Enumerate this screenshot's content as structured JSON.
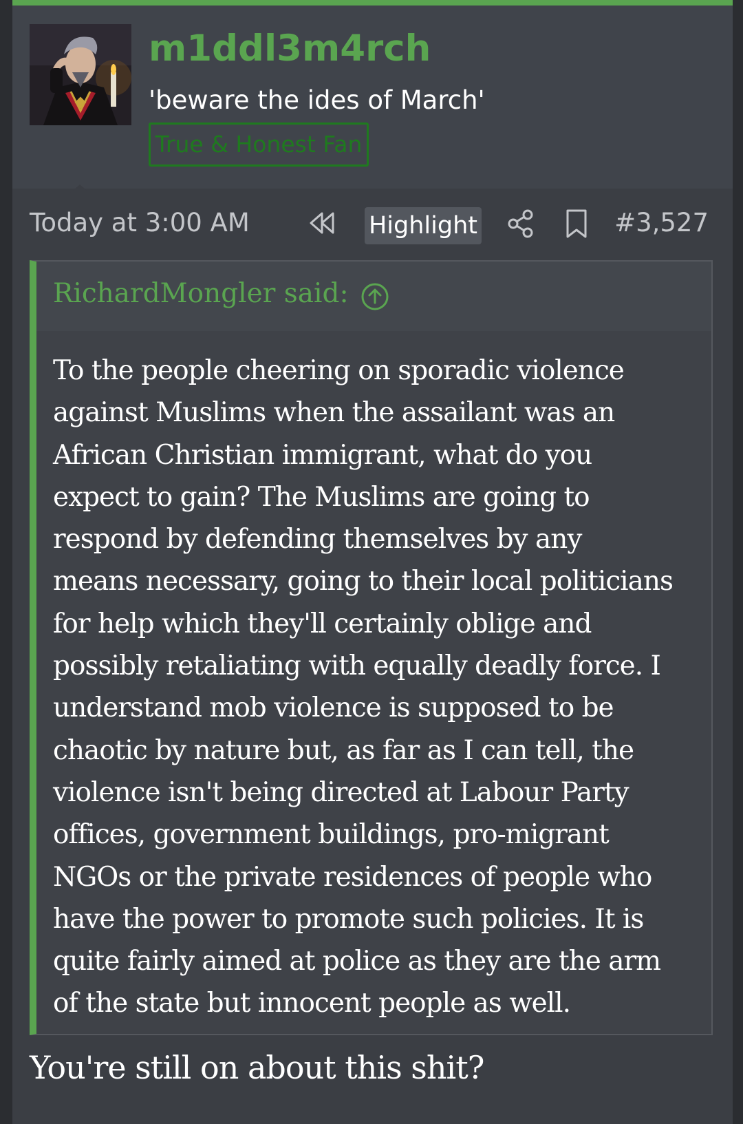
{
  "user": {
    "username": "m1ddl3m4rch",
    "custom_title": "'beware the ides of March'",
    "badge": "True & Honest Fan"
  },
  "post_meta": {
    "timestamp": "Today at 3:00 AM",
    "highlight_label": "Highlight",
    "post_number": "#3,527",
    "icons": [
      "rewind-icon",
      "share-icon",
      "bookmark-icon"
    ]
  },
  "quote": {
    "author_line": "RichardMongler said:",
    "jump_icon": "arrow-up-circle-icon",
    "lines": [
      "To the people cheering on sporadic violence",
      "against Muslims when the assailant was an",
      "African Christian immigrant, what do you",
      "expect to gain? The Muslims are going to",
      "respond by defending themselves by any",
      "means necessary, going to their local politicians",
      "for help which they'll certainly oblige and",
      "possibly retaliating with equally deadly force. I",
      "understand mob violence is supposed to be",
      "chaotic by nature but, as far as I can tell, the",
      "violence isn't being directed at Labour Party",
      "offices, government buildings, pro-migrant",
      "NGOs or the private residences of people who",
      "have the power to promote such policies. It is",
      "quite fairly aimed at police as they are the arm",
      "of the state but innocent people as well."
    ]
  },
  "reply": {
    "text": "You're still on about this shit?"
  },
  "colors": {
    "accent": "#5aa550",
    "badge": "#1f7a1f",
    "background": "#3b3e44",
    "text": "#ffffff"
  }
}
